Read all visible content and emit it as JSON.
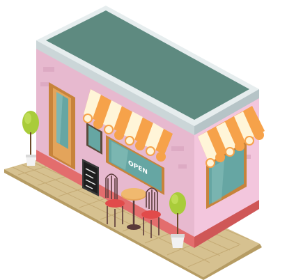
{
  "scene": {
    "window_sign_text": "OPEN"
  },
  "colors": {
    "roof_top": "#5E8A80",
    "roof_trim": "#E6EDEE",
    "wall_front": "#E7B9CF",
    "wall_side": "#F3C6DD",
    "base_stripe": "#E36D6D",
    "door_frame": "#C7833B",
    "window_glass": "#66A6A3",
    "awning_orange": "#F6A24A",
    "awning_cream": "#FFF5D8",
    "floor_tile_light": "#D6C190",
    "floor_tile_dark": "#B69C63",
    "tree_green": "#A9CC3A",
    "chair_red": "#E14B4B",
    "table_top": "#E6A55A"
  },
  "icons": [
    "plant-icon",
    "chair-icon",
    "table-icon",
    "awning-icon",
    "menu-board-icon",
    "window-icon",
    "door-icon"
  ]
}
